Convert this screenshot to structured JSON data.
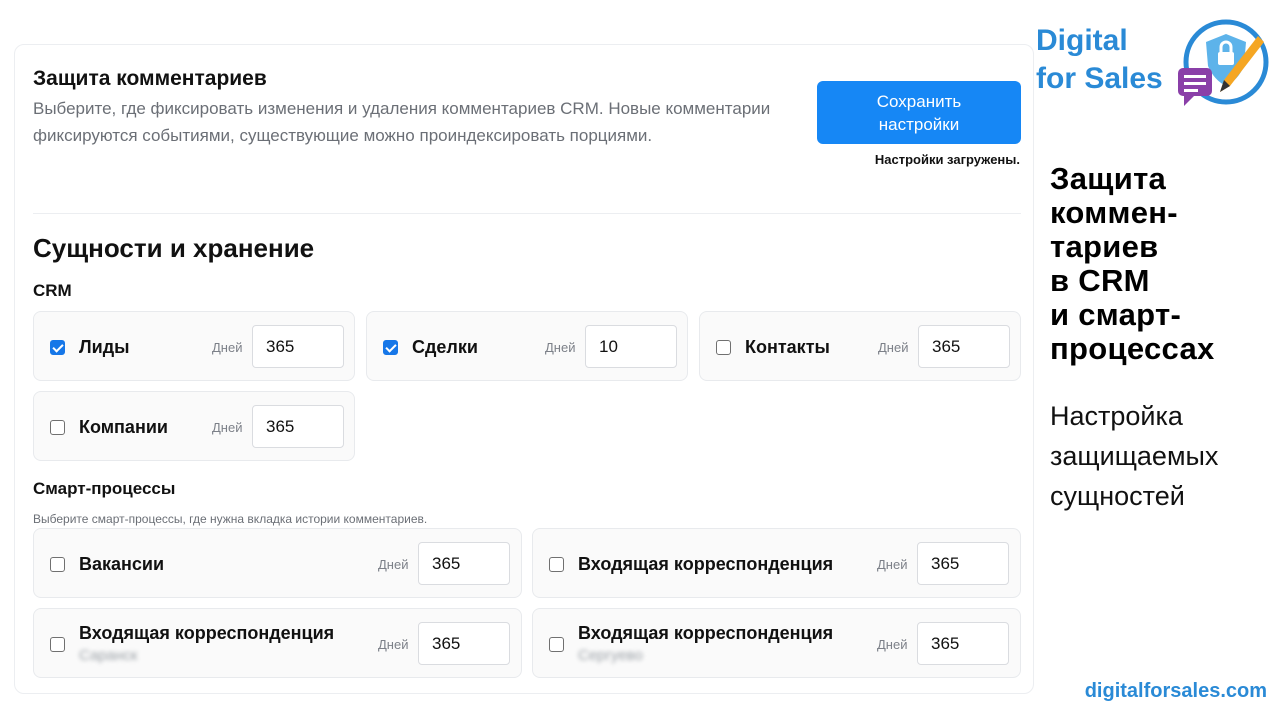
{
  "header": {
    "title": "Защита комментариев",
    "description": "Выберите, где фиксировать изменения и удаления комментариев CRM. Новые комментарии фиксируются событиями, существующие можно проиндексировать порциями.",
    "save_button_line1": "Сохранить",
    "save_button_line2": "настройки",
    "status": "Настройки загружены."
  },
  "section": {
    "title": "Сущности и хранение"
  },
  "crm": {
    "title": "CRM",
    "items": [
      {
        "label": "Лиды",
        "checked": true,
        "days_label": "Дней",
        "days": "365"
      },
      {
        "label": "Сделки",
        "checked": true,
        "days_label": "Дней",
        "days": "10"
      },
      {
        "label": "Контакты",
        "checked": false,
        "days_label": "Дней",
        "days": "365"
      },
      {
        "label": "Компании",
        "checked": false,
        "days_label": "Дней",
        "days": "365"
      }
    ]
  },
  "smart": {
    "title": "Смарт-процессы",
    "hint": "Выберите смарт-процессы, где нужна вкладка истории комментариев.",
    "items": [
      {
        "label": "Вакансии",
        "checked": false,
        "days_label": "Дней",
        "days": "365"
      },
      {
        "label": "Входящая корреспонденция",
        "checked": false,
        "days_label": "Дней",
        "days": "365"
      },
      {
        "label": "Входящая корреспонденция",
        "sub": "Саранск",
        "checked": false,
        "days_label": "Дней",
        "days": "365"
      },
      {
        "label": "Входящая корреспонденция",
        "sub": "Сергуево",
        "checked": false,
        "days_label": "Дней",
        "days": "365"
      }
    ]
  },
  "branding": {
    "logo_line1": "Digital",
    "logo_line2": "for Sales",
    "heading_lines": [
      "Защита",
      "коммен-",
      "тариев",
      "в CRM",
      "и смарт-",
      "процессах"
    ],
    "subheading_lines": [
      "Настройка",
      "защищаемых",
      "сущностей"
    ],
    "url": "digitalforsales.com",
    "brand_color": "#2a8ad6",
    "accent_color": "#1687f5"
  }
}
